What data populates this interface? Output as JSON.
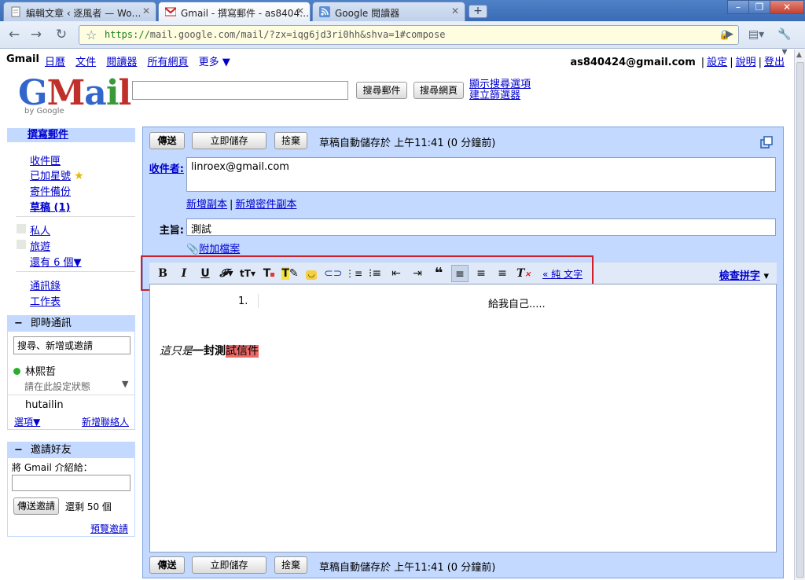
{
  "browser": {
    "tabs": [
      {
        "title": "編輯文章 ‹ 逐風者 — Wo…",
        "icon": "page-icon"
      },
      {
        "title": "Gmail - 撰寫郵件 - as8404…",
        "icon": "gmail-icon"
      },
      {
        "title": "Google 閱讀器",
        "icon": "rss-icon"
      }
    ],
    "url_scheme": "https://",
    "url_rest": "mail.google.com/mail/?zx=iqg6jd3ri0hh&shva=1#compose"
  },
  "topbar": {
    "brand": "Gmail",
    "links": [
      "日曆",
      "文件",
      "閱讀器",
      "所有網頁",
      "更多 ▼"
    ],
    "user_email": "as840424@gmail.com",
    "settings": "設定",
    "help": "說明",
    "signout": "登出"
  },
  "search": {
    "logo_text": "Gmail",
    "by_google": "by Google",
    "search_mail_button": "搜尋郵件",
    "search_web_button": "搜尋網頁",
    "show_options": "顯示搜尋選項",
    "create_filter": "建立篩選器"
  },
  "sidebar": {
    "compose": "撰寫郵件",
    "inbox": "收件匣",
    "starred": "已加星號",
    "sent": "寄件備份",
    "drafts": "草稿 (1)",
    "labels": [
      "私人",
      "旅遊"
    ],
    "more_labels": "還有 6 個▼",
    "contacts": "通訊錄",
    "tasks": "工作表",
    "chat": {
      "title": "即時通訊",
      "search_placeholder": "搜尋、新增或邀請",
      "me_name": "林熙哲",
      "status_placeholder": "請在此設定狀態",
      "contact": "hutailin",
      "options": "選項▼",
      "add_contact": "新增聯絡人"
    },
    "invite": {
      "title": "邀請好友",
      "label": "將 Gmail 介紹給：",
      "send_button": "傳送邀請",
      "remaining": "還剩 50 個",
      "preview": "預覽邀請"
    }
  },
  "compose": {
    "send": "傳送",
    "save_now": "立即儲存",
    "discard": "捨棄",
    "autosave_status": "草稿自動儲存於 上午11:41 (0 分鐘前)",
    "to_label": "收件者:",
    "to_value": "linroex@gmail.com",
    "add_cc": "新增副本",
    "add_bcc": "新增密件副本",
    "subject_label": "主旨:",
    "subject_value": "測試",
    "attach": "附加檔案",
    "plain_text": "« 純 文字",
    "spell_check": "檢查拼字",
    "body": {
      "list_number": "1.",
      "list_item": "給我自己.....",
      "sample_italic": "這只是",
      "sample_bold": "一封測",
      "sample_highlight": "試信件"
    }
  },
  "colors": {
    "nav_blue": "#c3d9ff",
    "link": "#0000cc",
    "highlight_box": "#d0202a"
  }
}
